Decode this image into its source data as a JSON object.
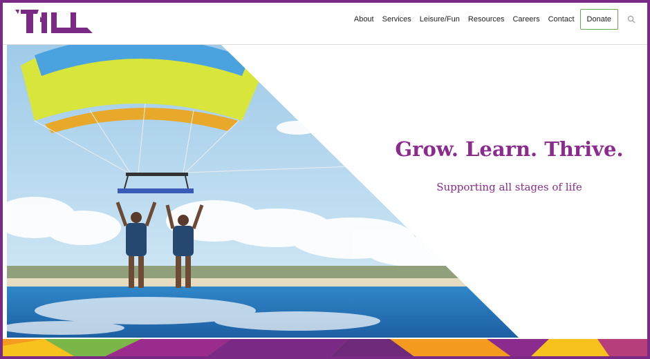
{
  "nav": {
    "items": [
      "About",
      "Services",
      "Leisure/Fun",
      "Resources",
      "Careers",
      "Contact"
    ],
    "donate_label": "Donate"
  },
  "icons": {
    "search": "search-icon"
  },
  "hero": {
    "headline": "Grow. Learn. Thrive.",
    "subheadline": "Supporting all stages of life"
  },
  "colors": {
    "brand_purple": "#7a2a84",
    "headline_purple": "#8c2b8e",
    "donate_border": "#6aa84f"
  }
}
